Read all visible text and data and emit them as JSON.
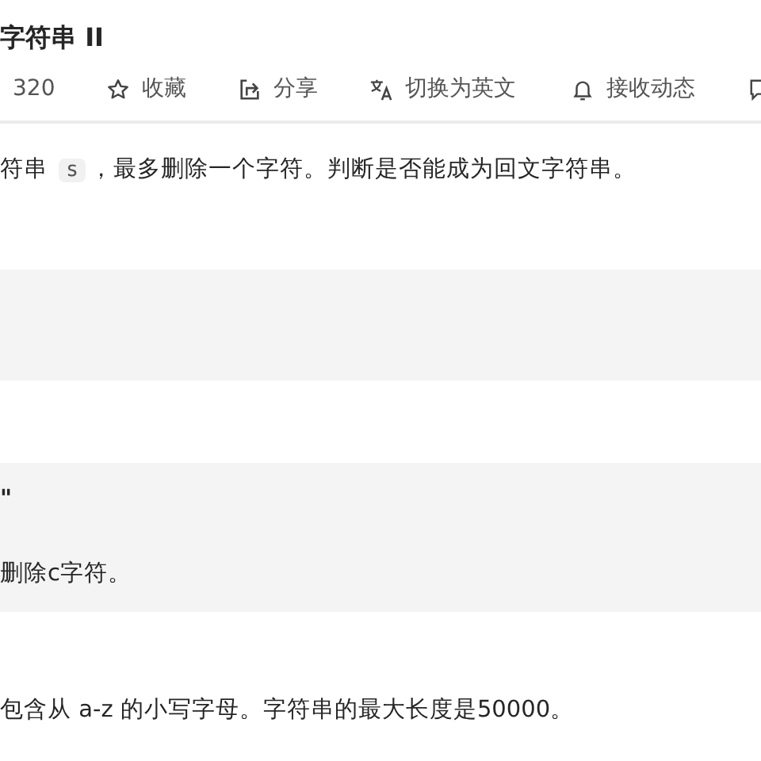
{
  "title": "字符串 II",
  "toolbar": [
    {
      "kind": "count",
      "label": "320"
    },
    {
      "kind": "star",
      "label": "收藏"
    },
    {
      "kind": "share",
      "label": "分享"
    },
    {
      "kind": "translate",
      "label": "切换为英文"
    },
    {
      "kind": "bell",
      "label": "接收动态"
    },
    {
      "kind": "comment"
    }
  ],
  "description": [
    {
      "kind": "text",
      "text": "符串 "
    },
    {
      "kind": "code",
      "text": "s"
    },
    {
      "kind": "text",
      "text": "，最多删除一个字符。判断是否能成为回文字符串。"
    }
  ],
  "example_blocks": [
    {
      "kind": "blank"
    },
    {
      "kind": "text",
      "lines": [
        "\"",
        "删除c字符。"
      ]
    }
  ],
  "note": "包含从 a-z 的小写字母。字符串的最大长度是50000。"
}
